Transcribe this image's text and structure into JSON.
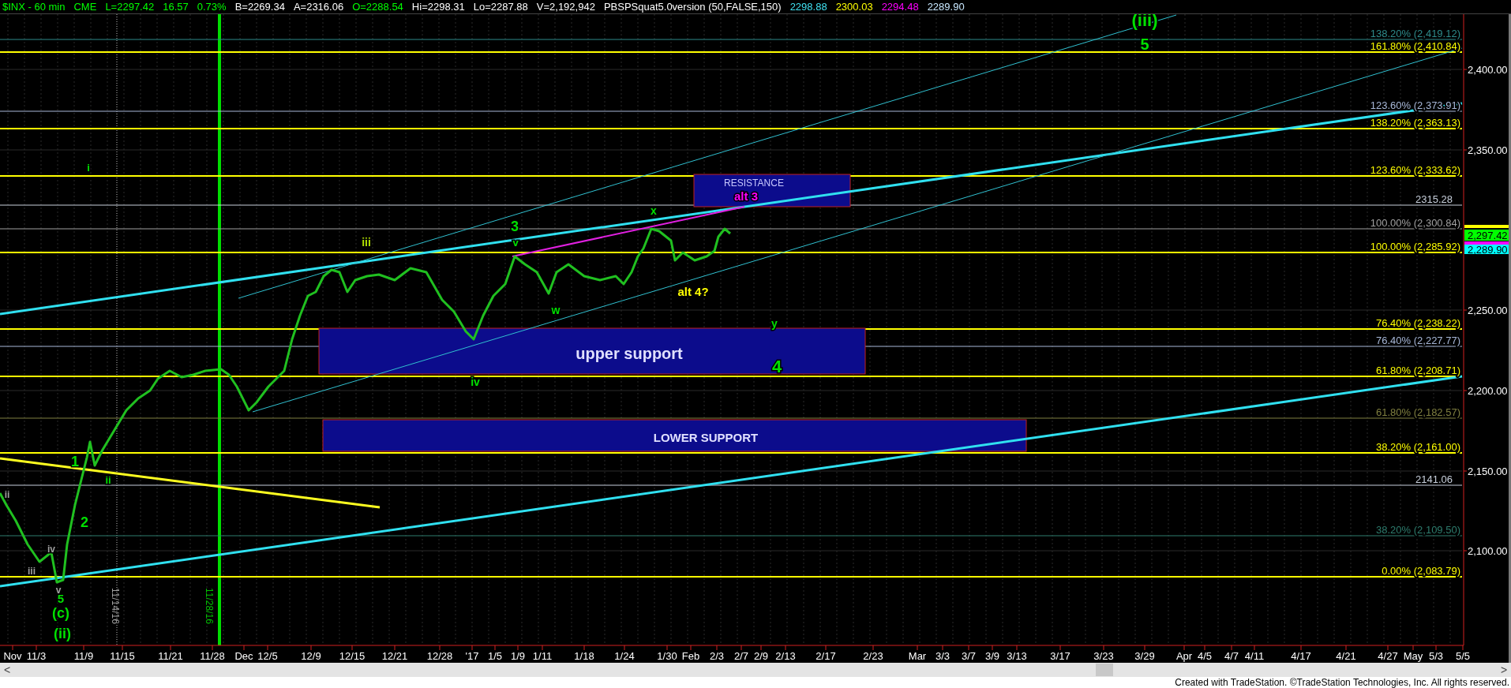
{
  "header": {
    "items": [
      {
        "text": "$INX - 60 min",
        "color": "#00ff00"
      },
      {
        "text": "CME",
        "color": "#00ff00"
      },
      {
        "text": "L=2297.42",
        "color": "#00ff00"
      },
      {
        "text": "16.57",
        "color": "#00ff00"
      },
      {
        "text": "0.73%",
        "color": "#00ff00"
      },
      {
        "text": "B=2269.34",
        "color": "#ffffff"
      },
      {
        "text": "A=2316.06",
        "color": "#ffffff"
      },
      {
        "text": "O=2288.54",
        "color": "#00ff00"
      },
      {
        "text": "Hi=2298.31",
        "color": "#ffffff"
      },
      {
        "text": "Lo=2287.88",
        "color": "#ffffff"
      },
      {
        "text": "V=2,192,942",
        "color": "#ffffff"
      },
      {
        "text": "PBSPSquat5.0version (50,FALSE,150)",
        "color": "#ffffff"
      },
      {
        "text": "2298.88",
        "color": "#40e0f0"
      },
      {
        "text": "2300.03",
        "color": "#ffff00"
      },
      {
        "text": "2294.48",
        "color": "#ff00ff"
      },
      {
        "text": "2289.90",
        "color": "#c8e8ff"
      }
    ]
  },
  "fib_levels": [
    {
      "label": "138.20% (2,419.12)",
      "color": "#2e8b8b"
    },
    {
      "label": "161.80% (2,410.84)",
      "color": "#ffff00"
    },
    {
      "label": "123.60% (2,373.91)",
      "color": "#a8b8d8"
    },
    {
      "label": "138.20% (2,363.13)",
      "color": "#ffff00"
    },
    {
      "label": "123.60% (2,333.62)",
      "color": "#ffff00"
    },
    {
      "label": "2315.28",
      "color": "#c8d0dc"
    },
    {
      "label": "100.00% (2,300.84)",
      "color": "#a0a0a0"
    },
    {
      "label": "100.00% (2,285.92)",
      "color": "#ffff00"
    },
    {
      "label": "76.40% (2,238.22)",
      "color": "#ffff00"
    },
    {
      "label": "76.40% (2,227.77)",
      "color": "#a8b8d8"
    },
    {
      "label": "61.80% (2,208.71)",
      "color": "#ffff00"
    },
    {
      "label": "61.80% (2,182.57)",
      "color": "#808040"
    },
    {
      "label": "38.20% (2,161.00)",
      "color": "#ffff00"
    },
    {
      "label": "2141.06",
      "color": "#c8d0dc"
    },
    {
      "label": "38.20% (2,109.50)",
      "color": "#2e7d6e"
    },
    {
      "label": "0.00% (2,083.79)",
      "color": "#ffff00"
    }
  ],
  "zones": {
    "resistance": "RESISTANCE",
    "upper_support": "upper support",
    "lower_support": "LOWER SUPPORT"
  },
  "wave_labels": [
    {
      "text": "(iii)",
      "color": "#00e000"
    },
    {
      "text": "5",
      "color": "#00e000"
    },
    {
      "text": "alt 3",
      "color": "#ff00ff"
    },
    {
      "text": "x",
      "color": "#00e000"
    },
    {
      "text": "3",
      "color": "#00e000"
    },
    {
      "text": "v",
      "color": "#00e000"
    },
    {
      "text": "iii",
      "color": "#b0e000"
    },
    {
      "text": "alt 4?",
      "color": "#ffff00"
    },
    {
      "text": "w",
      "color": "#00e000"
    },
    {
      "text": "iv",
      "color": "#00e000"
    },
    {
      "text": "y",
      "color": "#00e000"
    },
    {
      "text": "4",
      "color": "#00e000"
    },
    {
      "text": "i",
      "color": "#00e000"
    },
    {
      "text": "1",
      "color": "#00e000"
    },
    {
      "text": "ii",
      "color": "#00e000"
    },
    {
      "text": "2",
      "color": "#00e000"
    },
    {
      "text": "ii",
      "color": "#a0a0a0"
    },
    {
      "text": "iv",
      "color": "#a0a0a0"
    },
    {
      "text": "iii",
      "color": "#a0a0a0"
    },
    {
      "text": "v",
      "color": "#a0a0a0"
    },
    {
      "text": "5",
      "color": "#00e000"
    },
    {
      "text": "(c)",
      "color": "#00e000"
    },
    {
      "text": "(ii)",
      "color": "#00e000"
    }
  ],
  "date_markers": [
    {
      "text": "11/14/16",
      "color": "#a0a0a0"
    },
    {
      "text": "11/28/16",
      "color": "#00c000"
    }
  ],
  "price_axis": {
    "ticks": [
      "2,400.00",
      "2,350.00",
      "2,250.00",
      "2,200.00",
      "2,150.00",
      "2,100.00"
    ],
    "tags": [
      {
        "color": "#ffff00"
      },
      {
        "text": "2,297.42",
        "color": "#00ff00"
      },
      {
        "color": "#ff00ff"
      },
      {
        "text": "2,289.90",
        "color": "#00ffff"
      }
    ]
  },
  "date_axis": {
    "ticks": [
      "Nov",
      "11/3",
      "11/9",
      "11/15",
      "11/21",
      "11/28",
      "Dec",
      "12/5",
      "12/9",
      "12/15",
      "12/21",
      "12/28",
      "'17",
      "1/5",
      "1/9",
      "1/11",
      "1/18",
      "1/24",
      "1/30",
      "Feb",
      "2/3",
      "2/7",
      "2/9",
      "2/13",
      "2/17",
      "2/23",
      "Mar",
      "3/3",
      "3/7",
      "3/9",
      "3/13",
      "3/17",
      "3/23",
      "3/29",
      "Apr",
      "4/5",
      "4/7",
      "4/11",
      "4/17",
      "4/21",
      "4/27",
      "May",
      "5/3",
      "5/5"
    ]
  },
  "scrollbar": {
    "left": "<",
    "right": ">"
  },
  "footer": "Created with TradeStation. ©TradeStation Technologies, Inc. All rights reserved."
}
